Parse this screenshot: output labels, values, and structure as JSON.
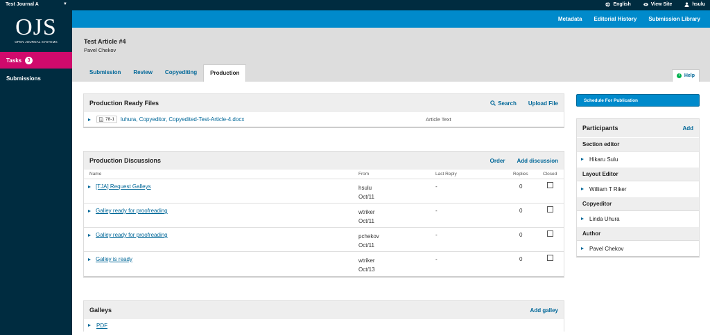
{
  "topbar": {
    "journal": "Test Journal A",
    "language": "English",
    "view_site": "View Site",
    "username": "hsulu"
  },
  "sidebar": {
    "logo_text": "OJS",
    "logo_subtitle": "OPEN JOURNAL SYSTEMS",
    "tasks_label": "Tasks",
    "tasks_count": "3",
    "submissions_label": "Submissions"
  },
  "appbar": {
    "links": [
      "Metadata",
      "Editorial History",
      "Submission Library"
    ]
  },
  "article": {
    "title": "Test Article #4",
    "author": "Pavel Chekov"
  },
  "tabs": [
    {
      "label": "Submission",
      "active": false
    },
    {
      "label": "Review",
      "active": false
    },
    {
      "label": "Copyediting",
      "active": false
    },
    {
      "label": "Production",
      "active": true
    }
  ],
  "help_label": "Help",
  "production_files": {
    "title": "Production Ready Files",
    "search_label": "Search",
    "upload_label": "Upload File",
    "files": [
      {
        "id": "78-1",
        "name": "luhura, Copyeditor, Copyedited-Test-Article-4.docx",
        "type": "Article Text"
      }
    ]
  },
  "discussions": {
    "title": "Production Discussions",
    "order_label": "Order",
    "add_label": "Add discussion",
    "columns": [
      "Name",
      "From",
      "Last Reply",
      "Replies",
      "Closed"
    ],
    "rows": [
      {
        "name": "[TJA] Request Galleys",
        "from_user": "hsulu",
        "from_date": "Oct/11",
        "last_reply": "-",
        "replies": "0",
        "closed": false
      },
      {
        "name": "Galley ready for proofreading",
        "from_user": "wtriker",
        "from_date": "Oct/11",
        "last_reply": "-",
        "replies": "0",
        "closed": false
      },
      {
        "name": "Galley ready for proofreading",
        "from_user": "pchekov",
        "from_date": "Oct/11",
        "last_reply": "-",
        "replies": "0",
        "closed": false
      },
      {
        "name": "Galley is ready",
        "from_user": "wtriker",
        "from_date": "Oct/13",
        "last_reply": "-",
        "replies": "0",
        "closed": false
      }
    ]
  },
  "galleys": {
    "title": "Galleys",
    "add_label": "Add galley",
    "items": [
      {
        "label": "PDF"
      }
    ]
  },
  "schedule_button": "Schedule For Publication",
  "participants": {
    "title": "Participants",
    "add_label": "Add",
    "groups": [
      {
        "role": "Section editor",
        "person": "Hikaru Sulu"
      },
      {
        "role": "Layout Editor",
        "person": "William T Riker"
      },
      {
        "role": "Copyeditor",
        "person": "Linda Uhura"
      },
      {
        "role": "Author",
        "person": "Pavel Chekov"
      }
    ]
  },
  "colors": {
    "dark_navy": "#002c40",
    "primary_blue": "#008acb",
    "tasks_pink": "#d00a6c",
    "link_blue": "#006798"
  }
}
